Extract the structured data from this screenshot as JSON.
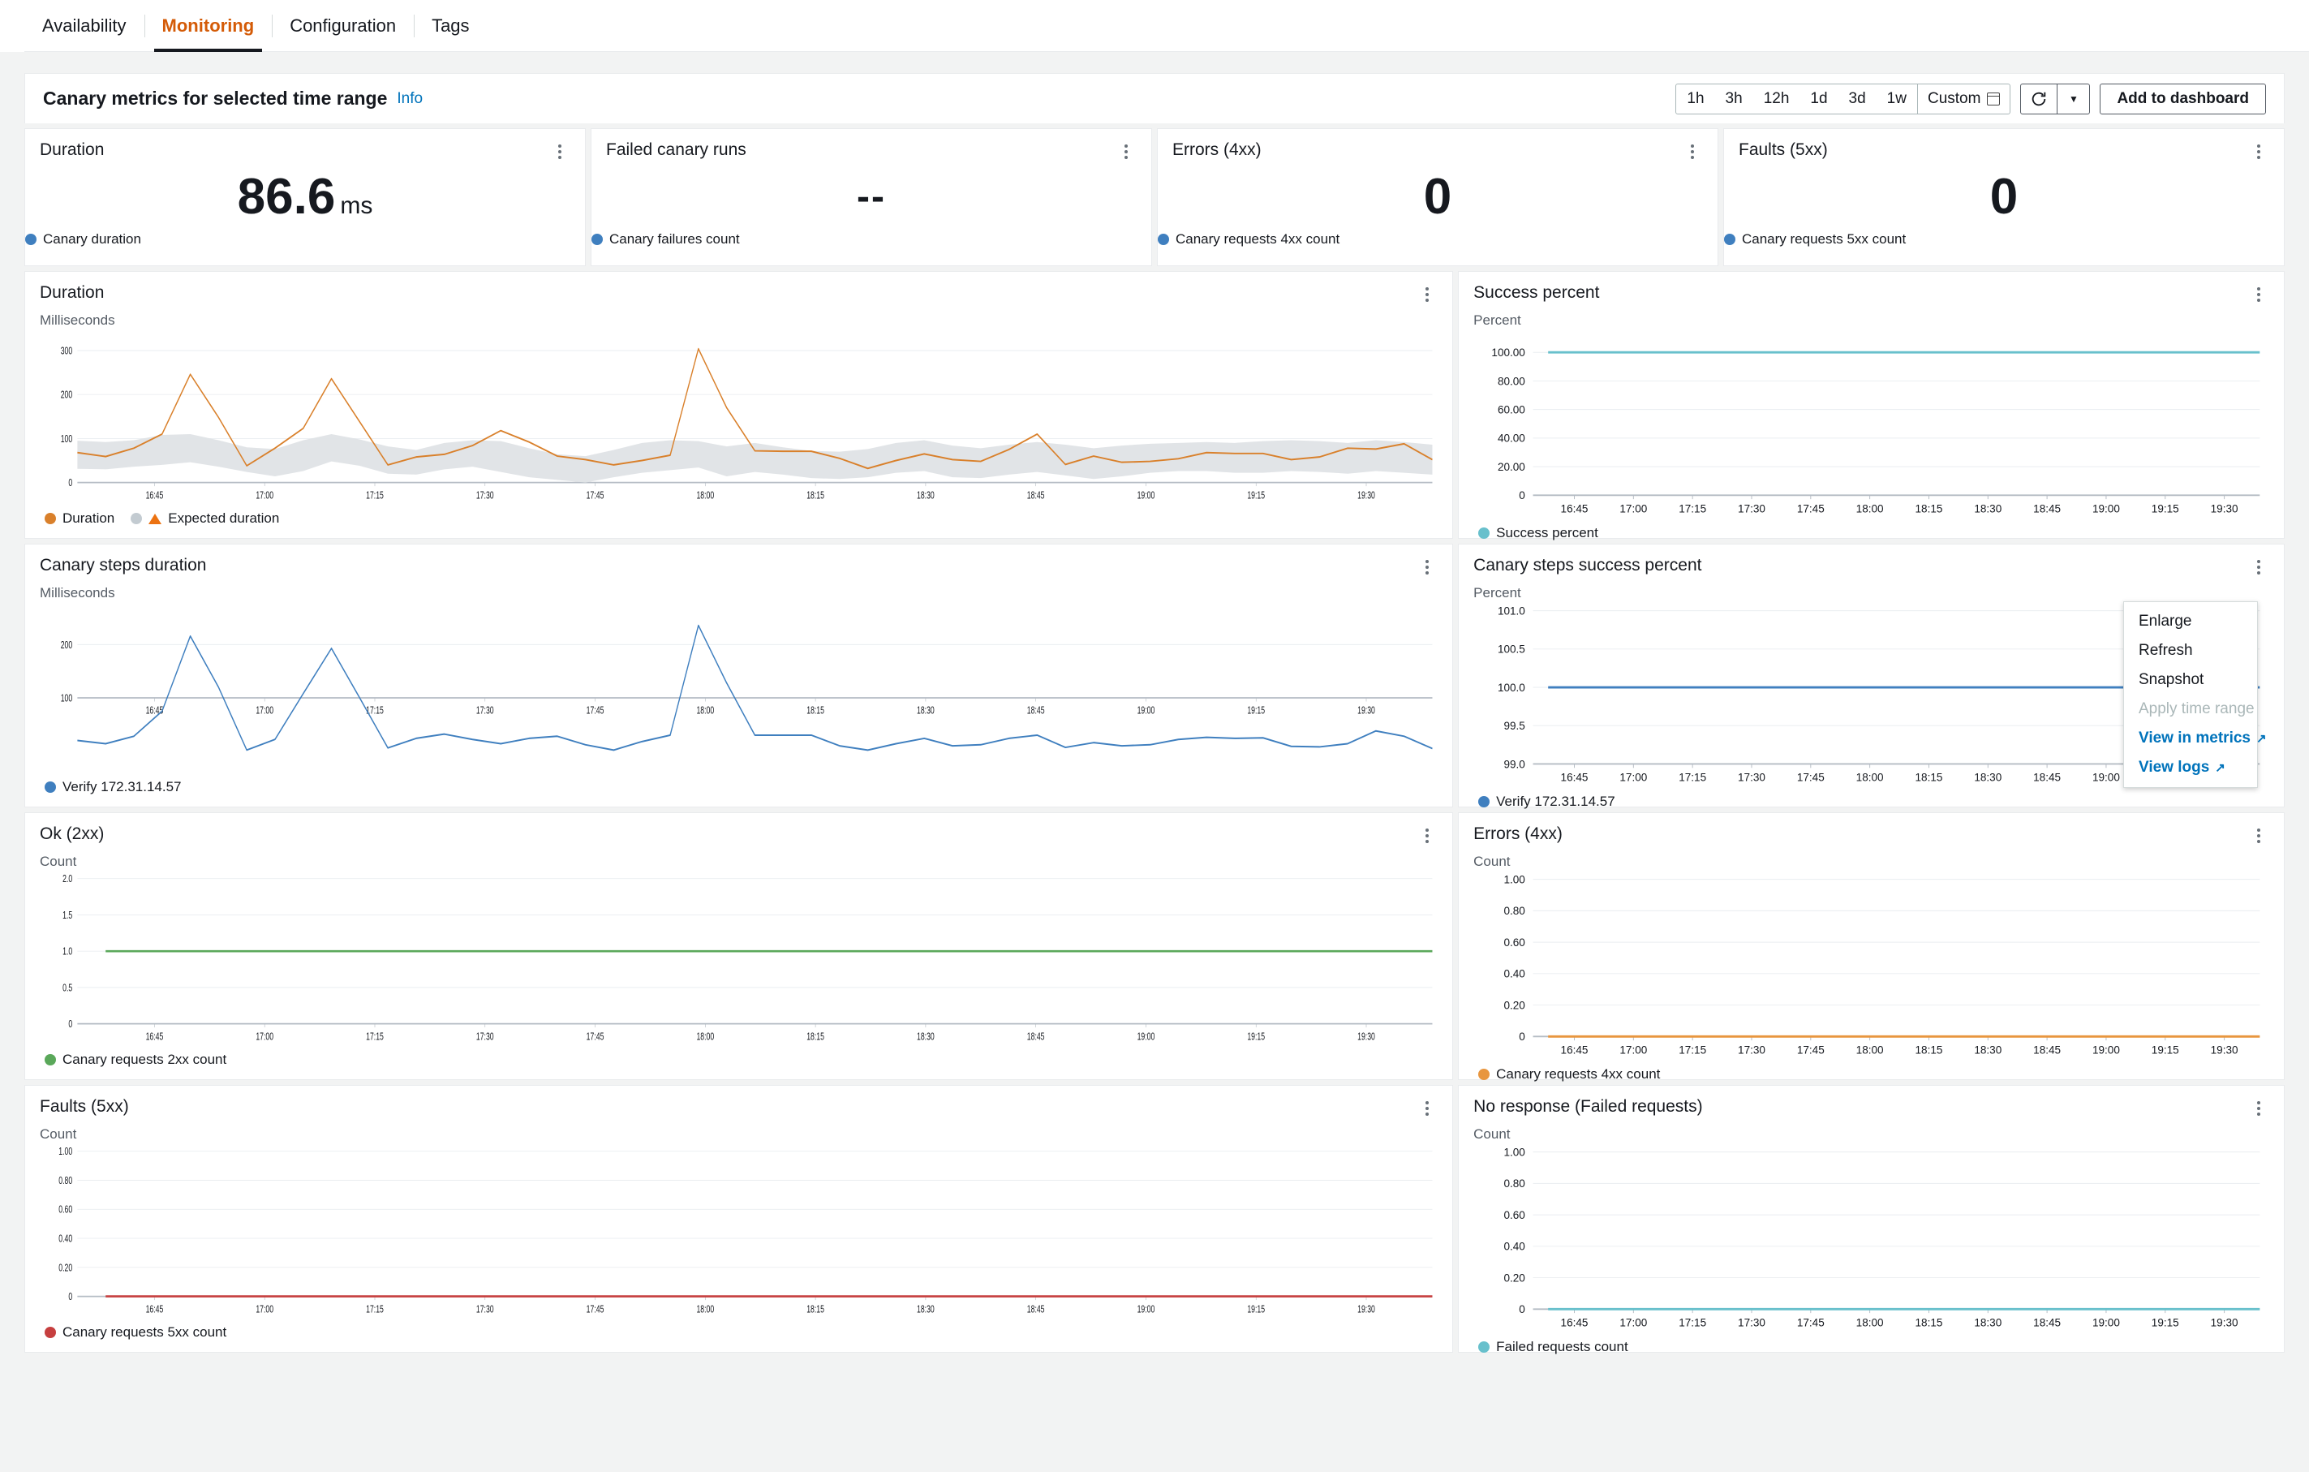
{
  "tabs": [
    {
      "label": "Availability",
      "active": false
    },
    {
      "label": "Monitoring",
      "active": true
    },
    {
      "label": "Configuration",
      "active": false
    },
    {
      "label": "Tags",
      "active": false
    }
  ],
  "section": {
    "title": "Canary metrics for selected time range",
    "info_label": "Info",
    "time_ranges": [
      "1h",
      "3h",
      "12h",
      "1d",
      "3d",
      "1w"
    ],
    "custom_label": "Custom",
    "calendar_icon": "calendar-icon",
    "refresh_icon": "refresh-icon",
    "caret_icon": "chevron-down-icon",
    "add_to_dashboard_label": "Add to dashboard"
  },
  "kpis": [
    {
      "title": "Duration",
      "value": "86.6",
      "unit": "ms",
      "legend": "Canary duration",
      "color": "#3f7fbf"
    },
    {
      "title": "Failed canary runs",
      "value": "--",
      "unit": "",
      "legend": "Canary failures count",
      "color": "#3f7fbf"
    },
    {
      "title": "Errors (4xx)",
      "value": "0",
      "unit": "",
      "legend": "Canary requests 4xx count",
      "color": "#3f7fbf"
    },
    {
      "title": "Faults (5xx)",
      "value": "0",
      "unit": "",
      "legend": "Canary requests 5xx count",
      "color": "#3f7fbf"
    }
  ],
  "menu": {
    "items": [
      {
        "label": "Enlarge",
        "state": "normal"
      },
      {
        "label": "Refresh",
        "state": "normal"
      },
      {
        "label": "Snapshot",
        "state": "normal"
      },
      {
        "label": "Apply time range",
        "state": "disabled"
      },
      {
        "label": "View in metrics",
        "state": "link",
        "icon": "external-link-icon"
      },
      {
        "label": "View logs",
        "state": "link",
        "icon": "external-link-icon"
      }
    ]
  },
  "chart_data": [
    {
      "id": "duration",
      "type": "line",
      "title": "Duration",
      "ylabel": "Milliseconds",
      "xlabel": "",
      "ylim": [
        0,
        330
      ],
      "yticks": [
        0,
        100,
        200,
        300
      ],
      "ytick_labels": [
        "0",
        "100",
        "200",
        "300"
      ],
      "xticks": [
        "16:45",
        "17:00",
        "17:15",
        "17:30",
        "17:45",
        "18:00",
        "18:15",
        "18:30",
        "18:45",
        "19:00",
        "19:15",
        "19:30"
      ],
      "grid": true,
      "legend": [
        {
          "name": "Duration",
          "color": "#d9802b",
          "marker": "dot"
        },
        {
          "name": "Expected duration",
          "color": "#95a5a6",
          "marker": "band"
        }
      ],
      "series": [
        {
          "name": "Duration",
          "color": "#d9802b",
          "values": [
            68,
            59,
            78,
            110,
            246,
            148,
            38,
            78,
            123,
            236,
            138,
            40,
            58,
            64,
            84,
            118,
            92,
            60,
            52,
            40,
            50,
            62,
            304,
            170,
            72,
            71,
            71,
            55,
            32,
            50,
            65,
            52,
            48,
            75,
            110,
            41,
            60,
            46,
            48,
            54,
            68,
            66,
            66,
            52,
            58,
            78,
            76,
            88,
            52
          ]
        },
        {
          "name": "Expected duration upper",
          "color": "#dfe3e6",
          "values": [
            95,
            92,
            96,
            108,
            110,
            96,
            80,
            76,
            96,
            110,
            98,
            82,
            74,
            90,
            96,
            94,
            78,
            64,
            60,
            74,
            90,
            96,
            94,
            82,
            90,
            80,
            72,
            70,
            76,
            90,
            96,
            84,
            78,
            86,
            92,
            86,
            78,
            84,
            88,
            90,
            92,
            90,
            94,
            96,
            94,
            90,
            96,
            92,
            86
          ]
        },
        {
          "name": "Expected duration lower",
          "color": "#dfe3e6",
          "values": [
            31,
            30,
            36,
            40,
            46,
            36,
            24,
            14,
            26,
            48,
            38,
            20,
            18,
            30,
            36,
            24,
            12,
            6,
            0,
            12,
            22,
            28,
            34,
            14,
            24,
            18,
            10,
            8,
            12,
            22,
            26,
            12,
            10,
            18,
            24,
            16,
            8,
            14,
            22,
            26,
            26,
            22,
            22,
            26,
            24,
            20,
            26,
            22,
            18
          ]
        }
      ]
    },
    {
      "id": "success-percent",
      "type": "line",
      "title": "Success percent",
      "ylabel": "Percent",
      "xlabel": "",
      "ylim": [
        0,
        110
      ],
      "yticks": [
        0,
        20,
        40,
        60,
        80,
        100
      ],
      "ytick_labels": [
        "0",
        "20.00",
        "40.00",
        "60.00",
        "80.00",
        "100.00"
      ],
      "xticks": [
        "16:45",
        "17:00",
        "17:15",
        "17:30",
        "17:45",
        "18:00",
        "18:15",
        "18:30",
        "18:45",
        "19:00",
        "19:15",
        "19:30"
      ],
      "grid": true,
      "legend": [
        {
          "name": "Success percent",
          "color": "#68c0cc",
          "marker": "dot"
        }
      ],
      "series": [
        {
          "name": "Success percent",
          "color": "#68c0cc",
          "constant": 100
        }
      ]
    },
    {
      "id": "canary-steps-duration",
      "type": "line",
      "title": "Canary steps duration",
      "ylabel": "Milliseconds",
      "xlabel": "",
      "ylim": [
        0,
        265
      ],
      "yticks": [
        100,
        200
      ],
      "ytick_labels": [
        "100",
        "200"
      ],
      "xticks": [
        "16:45",
        "17:00",
        "17:15",
        "17:30",
        "17:45",
        "18:00",
        "18:15",
        "18:30",
        "18:45",
        "19:00",
        "19:15",
        "19:30"
      ],
      "grid": true,
      "legend": [
        {
          "name": "Verify 172.31.14.57",
          "color": "#3f7fbf",
          "marker": "dot"
        }
      ],
      "series": [
        {
          "name": "Verify 172.31.14.57",
          "color": "#3f7fbf",
          "values": [
            20,
            14,
            28,
            75,
            216,
            120,
            2,
            22,
            108,
            193,
            100,
            6,
            24,
            32,
            22,
            14,
            24,
            28,
            12,
            2,
            18,
            30,
            236,
            128,
            30,
            30,
            30,
            10,
            2,
            14,
            24,
            10,
            12,
            24,
            30,
            7,
            16,
            10,
            12,
            22,
            26,
            24,
            25,
            9,
            8,
            14,
            38,
            28,
            5
          ]
        }
      ]
    },
    {
      "id": "canary-steps-success-percent",
      "type": "line",
      "title": "Canary steps success percent",
      "ylabel": "Percent",
      "xlabel": "",
      "ylim": [
        99.0,
        101.0
      ],
      "yticks": [
        99.0,
        99.5,
        100.0,
        100.5,
        101.0
      ],
      "ytick_labels": [
        "99.0",
        "99.5",
        "100.0",
        "100.5",
        "101.0"
      ],
      "xticks": [
        "16:45",
        "17:00",
        "17:15",
        "17:30",
        "17:45",
        "18:00",
        "18:15",
        "18:30",
        "18:45",
        "19:00",
        "19:15",
        "19:30"
      ],
      "grid": true,
      "legend": [
        {
          "name": "Verify 172.31.14.57",
          "color": "#3f7fbf",
          "marker": "dot"
        }
      ],
      "series": [
        {
          "name": "Verify 172.31.14.57",
          "color": "#3f7fbf",
          "constant": 100.0
        }
      ]
    },
    {
      "id": "ok-2xx",
      "type": "line",
      "title": "Ok (2xx)",
      "ylabel": "Count",
      "xlabel": "",
      "ylim": [
        0,
        2.0
      ],
      "yticks": [
        0,
        0.5,
        1.0,
        1.5,
        2.0
      ],
      "ytick_labels": [
        "0",
        "0.5",
        "1.0",
        "1.5",
        "2.0"
      ],
      "xticks": [
        "16:45",
        "17:00",
        "17:15",
        "17:30",
        "17:45",
        "18:00",
        "18:15",
        "18:30",
        "18:45",
        "19:00",
        "19:15",
        "19:30"
      ],
      "grid": true,
      "legend": [
        {
          "name": "Canary requests 2xx count",
          "color": "#5aa85a",
          "marker": "dot"
        }
      ],
      "series": [
        {
          "name": "Canary requests 2xx count",
          "color": "#5aa85a",
          "constant": 1.0
        }
      ]
    },
    {
      "id": "errors-4xx",
      "type": "line",
      "title": "Errors (4xx)",
      "ylabel": "Count",
      "xlabel": "",
      "ylim": [
        0,
        1.0
      ],
      "yticks": [
        0,
        0.2,
        0.4,
        0.6,
        0.8,
        1.0
      ],
      "ytick_labels": [
        "0",
        "0.20",
        "0.40",
        "0.60",
        "0.80",
        "1.00"
      ],
      "xticks": [
        "16:45",
        "17:00",
        "17:15",
        "17:30",
        "17:45",
        "18:00",
        "18:15",
        "18:30",
        "18:45",
        "19:00",
        "19:15",
        "19:30"
      ],
      "grid": true,
      "legend": [
        {
          "name": "Canary requests 4xx count",
          "color": "#e8963f",
          "marker": "dot"
        }
      ],
      "series": [
        {
          "name": "Canary requests 4xx count",
          "color": "#e8963f",
          "constant": 0
        }
      ]
    },
    {
      "id": "faults-5xx",
      "type": "line",
      "title": "Faults (5xx)",
      "ylabel": "Count",
      "xlabel": "",
      "ylim": [
        0,
        1.0
      ],
      "yticks": [
        0,
        0.2,
        0.4,
        0.6,
        0.8,
        1.0
      ],
      "ytick_labels": [
        "0",
        "0.20",
        "0.40",
        "0.60",
        "0.80",
        "1.00"
      ],
      "xticks": [
        "16:45",
        "17:00",
        "17:15",
        "17:30",
        "17:45",
        "18:00",
        "18:15",
        "18:30",
        "18:45",
        "19:00",
        "19:15",
        "19:30"
      ],
      "grid": true,
      "legend": [
        {
          "name": "Canary requests 5xx count",
          "color": "#c63f3f",
          "marker": "dot"
        }
      ],
      "series": [
        {
          "name": "Canary requests 5xx count",
          "color": "#c63f3f",
          "constant": 0
        }
      ]
    },
    {
      "id": "no-response",
      "type": "line",
      "title": "No response (Failed requests)",
      "ylabel": "Count",
      "xlabel": "",
      "ylim": [
        0,
        1.0
      ],
      "yticks": [
        0,
        0.2,
        0.4,
        0.6,
        0.8,
        1.0
      ],
      "ytick_labels": [
        "0",
        "0.20",
        "0.40",
        "0.60",
        "0.80",
        "1.00"
      ],
      "xticks": [
        "16:45",
        "17:00",
        "17:15",
        "17:30",
        "17:45",
        "18:00",
        "18:15",
        "18:30",
        "18:45",
        "19:00",
        "19:15",
        "19:30"
      ],
      "grid": true,
      "legend": [
        {
          "name": "Failed requests count",
          "color": "#68c0cc",
          "marker": "dot"
        }
      ],
      "series": [
        {
          "name": "Failed requests count",
          "color": "#68c0cc",
          "constant": 0
        }
      ]
    }
  ]
}
